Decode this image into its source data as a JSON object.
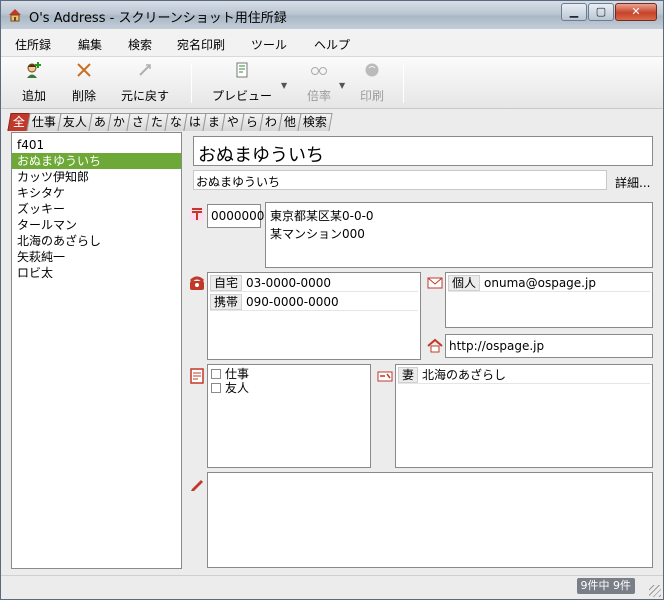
{
  "window": {
    "title": "O's Address - スクリーンショット用住所録"
  },
  "menu": [
    "住所録",
    "編集",
    "検索",
    "宛名印刷",
    "ツール",
    "ヘルプ"
  ],
  "toolbar": {
    "add": "追加",
    "delete": "削除",
    "undo": "元に戻す",
    "preview": "プレビュー",
    "zoom": "倍率",
    "print": "印刷"
  },
  "tabs": [
    "全",
    "仕事",
    "友人",
    "あ",
    "か",
    "さ",
    "た",
    "な",
    "は",
    "ま",
    "や",
    "ら",
    "わ",
    "他",
    "検索"
  ],
  "contacts": [
    "f401",
    "おぬまゆういち",
    "カッツ伊知郎",
    "キシタケ",
    "ズッキー",
    "タールマン",
    "北海のあざらし",
    "矢萩純一",
    "ロビ太"
  ],
  "detail": {
    "name": "おぬまゆういち",
    "reading": "おぬまゆういち",
    "more_label": "詳細...",
    "postal_code": "0000000",
    "address_line1": "東京都某区某0-0-0",
    "address_line2": "某マンション000",
    "phones": [
      {
        "type": "自宅",
        "number": "03-0000-0000"
      },
      {
        "type": "携帯",
        "number": "090-0000-0000"
      }
    ],
    "email": {
      "type": "個人",
      "address": "onuma@ospage.jp"
    },
    "url": "http://ospage.jp",
    "groups": [
      "仕事",
      "友人"
    ],
    "family": {
      "relation": "妻",
      "name": "北海のあざらし"
    },
    "memo": ""
  },
  "status": {
    "count": "9件中 9件"
  }
}
